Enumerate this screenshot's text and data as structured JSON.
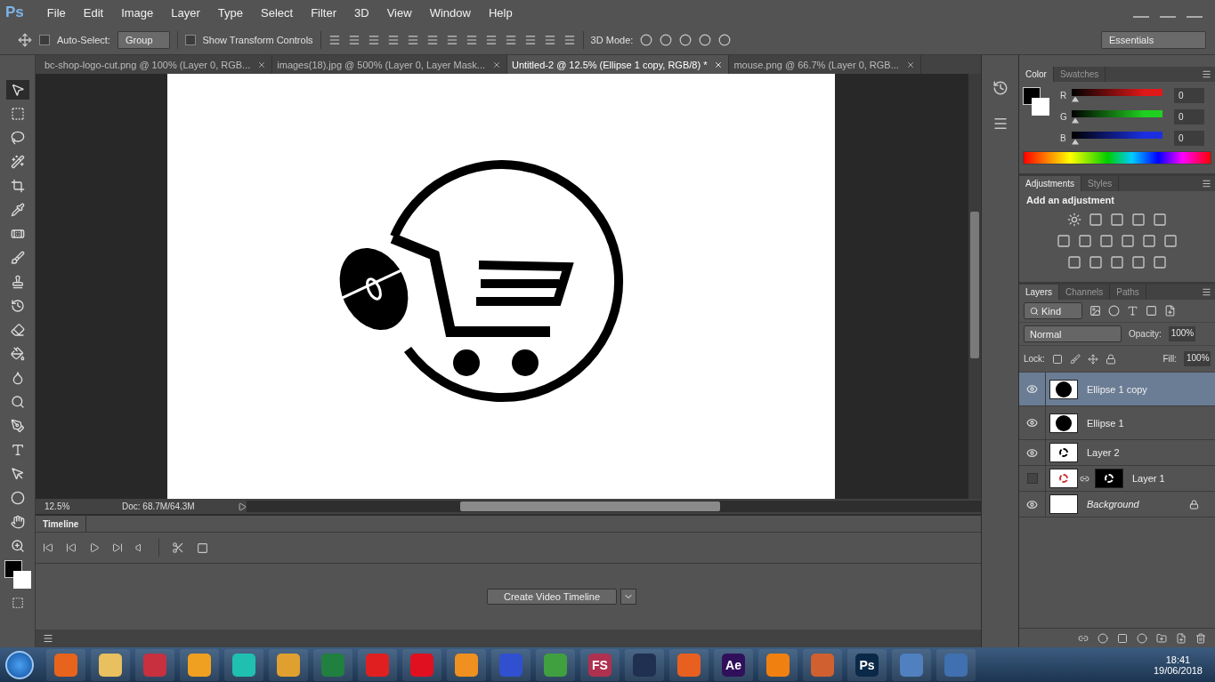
{
  "app_logo": "Ps",
  "menu": [
    "File",
    "Edit",
    "Image",
    "Layer",
    "Type",
    "Select",
    "Filter",
    "3D",
    "View",
    "Window",
    "Help"
  ],
  "options_bar": {
    "auto_select": {
      "label": "Auto-Select:",
      "checked": false
    },
    "group": "Group",
    "transform_controls": {
      "label": "Show Transform Controls",
      "checked": false
    },
    "mode_label": "3D Mode:",
    "workspace": "Essentials"
  },
  "document_tabs": [
    {
      "label": "bc-shop-logo-cut.png @ 100% (Layer 0, RGB...",
      "selected": false
    },
    {
      "label": "images(18).jpg @ 500% (Layer 0, Layer Mask...",
      "selected": false
    },
    {
      "label": "Untitled-2 @ 12.5% (Ellipse 1 copy, RGB/8) *",
      "selected": true
    },
    {
      "label": "mouse.png @ 66.7% (Layer 0, RGB...",
      "selected": false
    }
  ],
  "status_bar": {
    "zoom": "12.5%",
    "doc": "Doc: 68.7M/64.3M"
  },
  "timeline": {
    "title": "Timeline",
    "button": "Create Video Timeline"
  },
  "color_panel": {
    "tabs": [
      {
        "label": "Color",
        "selected": true
      },
      {
        "label": "Swatches",
        "selected": false
      }
    ],
    "channels": [
      {
        "label": "R",
        "value": "0",
        "color": "#e01818",
        "level": 0
      },
      {
        "label": "G",
        "value": "0",
        "color": "#20d020",
        "level": 0
      },
      {
        "label": "B",
        "value": "0",
        "color": "#1a30e0",
        "level": 0
      }
    ]
  },
  "adjustments_panel": {
    "tabs": [
      {
        "label": "Adjustments",
        "selected": true
      },
      {
        "label": "Styles",
        "selected": false
      }
    ],
    "heading": "Add an adjustment"
  },
  "layers_panel": {
    "tabs": [
      {
        "label": "Layers",
        "selected": true
      },
      {
        "label": "Channels",
        "selected": false
      },
      {
        "label": "Paths",
        "selected": false
      }
    ],
    "filter": "Kind",
    "blend_mode": "Normal",
    "opacity_label": "Opacity:",
    "opacity": "100%",
    "lock_label": "Lock:",
    "fill_label": "Fill:",
    "fill": "100%",
    "layers": [
      {
        "name": "Ellipse 1 copy",
        "kind": "shape",
        "visible": true,
        "selected": true
      },
      {
        "name": "Ellipse 1",
        "kind": "shape",
        "visible": true,
        "selected": false
      },
      {
        "name": "Layer 2",
        "kind": "pixel",
        "visible": true,
        "selected": false
      },
      {
        "name": "Layer 1",
        "kind": "masked",
        "visible": false,
        "selected": false
      },
      {
        "name": "Background",
        "kind": "background",
        "visible": true,
        "selected": false
      }
    ]
  },
  "taskbar": {
    "apps": [
      {
        "color": "#e8641c"
      },
      {
        "color": "#e8c060"
      },
      {
        "color": "#c83040"
      },
      {
        "color": "#f0a020"
      },
      {
        "color": "#20c0b0"
      },
      {
        "color": "#e0a030"
      },
      {
        "color": "#208040"
      },
      {
        "color": "#e02020"
      },
      {
        "color": "#e01020"
      },
      {
        "color": "#f09020"
      },
      {
        "color": "#3050d0"
      },
      {
        "color": "#40a040"
      },
      {
        "label": "FS",
        "color": "#b03050"
      },
      {
        "color": "#203050"
      },
      {
        "color": "#e86020"
      },
      {
        "label": "Ae",
        "color": "#30105a"
      },
      {
        "color": "#f08010"
      },
      {
        "color": "#d06030"
      },
      {
        "label": "Ps",
        "color": "#0a2848"
      },
      {
        "color": "#5080c0"
      },
      {
        "color": "#4070b0"
      }
    ],
    "time": "18:41",
    "date": "19/06/2018"
  }
}
